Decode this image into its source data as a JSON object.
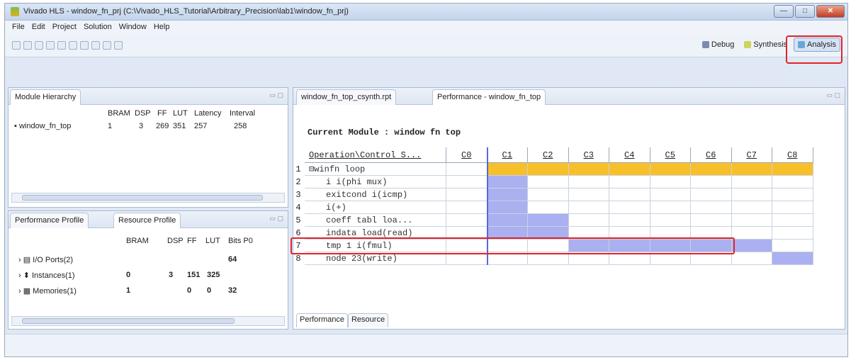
{
  "window": {
    "title": "Vivado HLS - window_fn_prj (C:\\Vivado_HLS_Tutorial\\Arbitrary_Precision\\lab1\\window_fn_prj)"
  },
  "window_buttons": {
    "minimize": "—",
    "maximize": "□",
    "close": "✕"
  },
  "menu": [
    "File",
    "Edit",
    "Project",
    "Solution",
    "Window",
    "Help"
  ],
  "perspectives": {
    "debug": "Debug",
    "synthesis": "Synthesis",
    "analysis": "Analysis"
  },
  "module_hierarchy": {
    "tab": "Module Hierarchy",
    "columns": [
      "BRAM",
      "DSP",
      "FF",
      "LUT",
      "Latency",
      "Interval"
    ],
    "rows": [
      {
        "name": "window_fn_top",
        "values": [
          "1",
          "3",
          "269",
          "351",
          "257",
          "258"
        ]
      }
    ]
  },
  "profile": {
    "tabs": [
      "Performance Profile",
      "Resource Profile"
    ],
    "columns": [
      "BRAM",
      "DSP",
      "FF",
      "LUT",
      "Bits P0"
    ],
    "rows": [
      {
        "name": "I/O Ports(2)",
        "values": [
          "",
          "",
          "",
          "",
          "64"
        ]
      },
      {
        "name": "Instances(1)",
        "values": [
          "0",
          "3",
          "151",
          "325",
          ""
        ]
      },
      {
        "name": "Memories(1)",
        "values": [
          "1",
          "",
          "0",
          "0",
          "32"
        ]
      }
    ]
  },
  "editor": {
    "tabs": [
      "window_fn_top_csynth.rpt",
      "Performance - window_fn_top"
    ],
    "current_module": "Current Module : window fn top",
    "header": "Operation\\Control S...",
    "steps": [
      "C0",
      "C1",
      "C2",
      "C3",
      "C4",
      "C5",
      "C6",
      "C7",
      "C8"
    ],
    "ops": [
      {
        "n": "1",
        "label": "⊟winfn loop"
      },
      {
        "n": "2",
        "label": "i i(phi mux)"
      },
      {
        "n": "3",
        "label": "exitcond i(icmp)"
      },
      {
        "n": "4",
        "label": "i(+)"
      },
      {
        "n": "5",
        "label": "coeff tabl loa..."
      },
      {
        "n": "6",
        "label": "indata load(read)"
      },
      {
        "n": "7",
        "label": "tmp 1 i(fmul)"
      },
      {
        "n": "8",
        "label": "node 23(write)"
      }
    ],
    "bottom_tabs": [
      "Performance",
      "Resource"
    ]
  },
  "colors": {
    "loop": "#f7c02a",
    "op": "#aab0f0",
    "highlight": "#e2222a"
  }
}
